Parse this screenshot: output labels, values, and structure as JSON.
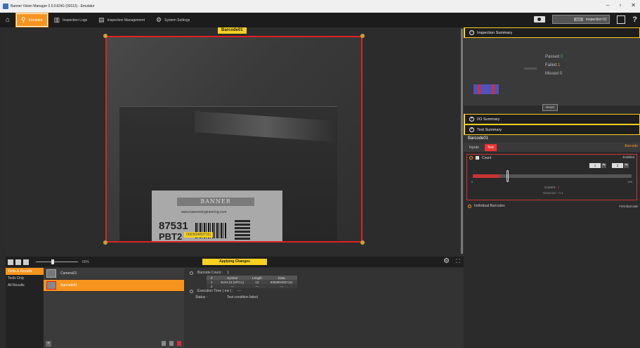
{
  "window": {
    "title": "Banner Vision Manager 2.0.0.ENG (00112) - Emulator",
    "controls": [
      "–",
      "▫",
      "✕"
    ]
  },
  "toolbar": {
    "tabs": [
      {
        "label": "Emulator",
        "icon": "search-icon",
        "active": true
      },
      {
        "label": "Inspection Logs",
        "icon": "logs-icon",
        "active": false
      },
      {
        "label": "Inspection Management",
        "icon": "management-icon",
        "active": false
      },
      {
        "label": "System Settings",
        "icon": "settings-icon",
        "active": false
      }
    ],
    "inspection_tag": "001",
    "inspection_name": "Inspection 01",
    "help": "?"
  },
  "viewport": {
    "roi_label": "Barcode01",
    "image_text": {
      "brand": "BANNER",
      "url": "www.bannerengineering.com",
      "number": "87531",
      "part": "PBT2",
      "barcode_result": "0063604837111"
    }
  },
  "bottom_bar": {
    "zoom": "60%",
    "status": "Applying Changes"
  },
  "tool_nav": {
    "items": [
      {
        "label": "Tools & Results",
        "active": true
      },
      {
        "label": "Tools Only",
        "active": false
      },
      {
        "label": "All Results",
        "active": false
      }
    ]
  },
  "tools_list": {
    "items": [
      {
        "label": "Camera01",
        "selected": false
      },
      {
        "label": "Barcode01",
        "selected": true
      }
    ],
    "add": "+"
  },
  "results": {
    "barcode_count_label": "Barcode Count :",
    "barcode_count_value": "1",
    "columns": [
      "#",
      "Symbol",
      "Length",
      "Data"
    ],
    "rows": [
      [
        "1",
        "EAN-13 (UPCA)",
        "13",
        "0063604837111"
      ],
      [
        "2",
        "---",
        "---",
        "---"
      ]
    ],
    "exec_time_label": "Execution Time ( ms ) :",
    "exec_time_value": "---",
    "status_label": "Status :",
    "status_value": "Test condition failed"
  },
  "right_panel": {
    "inspection_summary": "Inspection Summary",
    "passed_label": "Passed",
    "passed_value": "0",
    "failed_label": "Failed",
    "failed_value": "1",
    "missed_label": "Missed",
    "missed_value": "0",
    "reset": "Reset",
    "io_summary": "I/O Summary",
    "test_summary": "Test Summary",
    "tool_title": "Barcode01",
    "subtabs": [
      "Inputs",
      "Test"
    ],
    "subtab_right": "Barcode",
    "count_label": "Count",
    "count_state": "Enabled",
    "min_value": "1",
    "max_value": "2",
    "range_min": "0",
    "range_max": "100",
    "current_label": "Current :",
    "current_value": "1",
    "historical": "Historical : 0-1",
    "individual_barcodes": "Individual Barcodes",
    "first_barcode": "First Barcode"
  }
}
